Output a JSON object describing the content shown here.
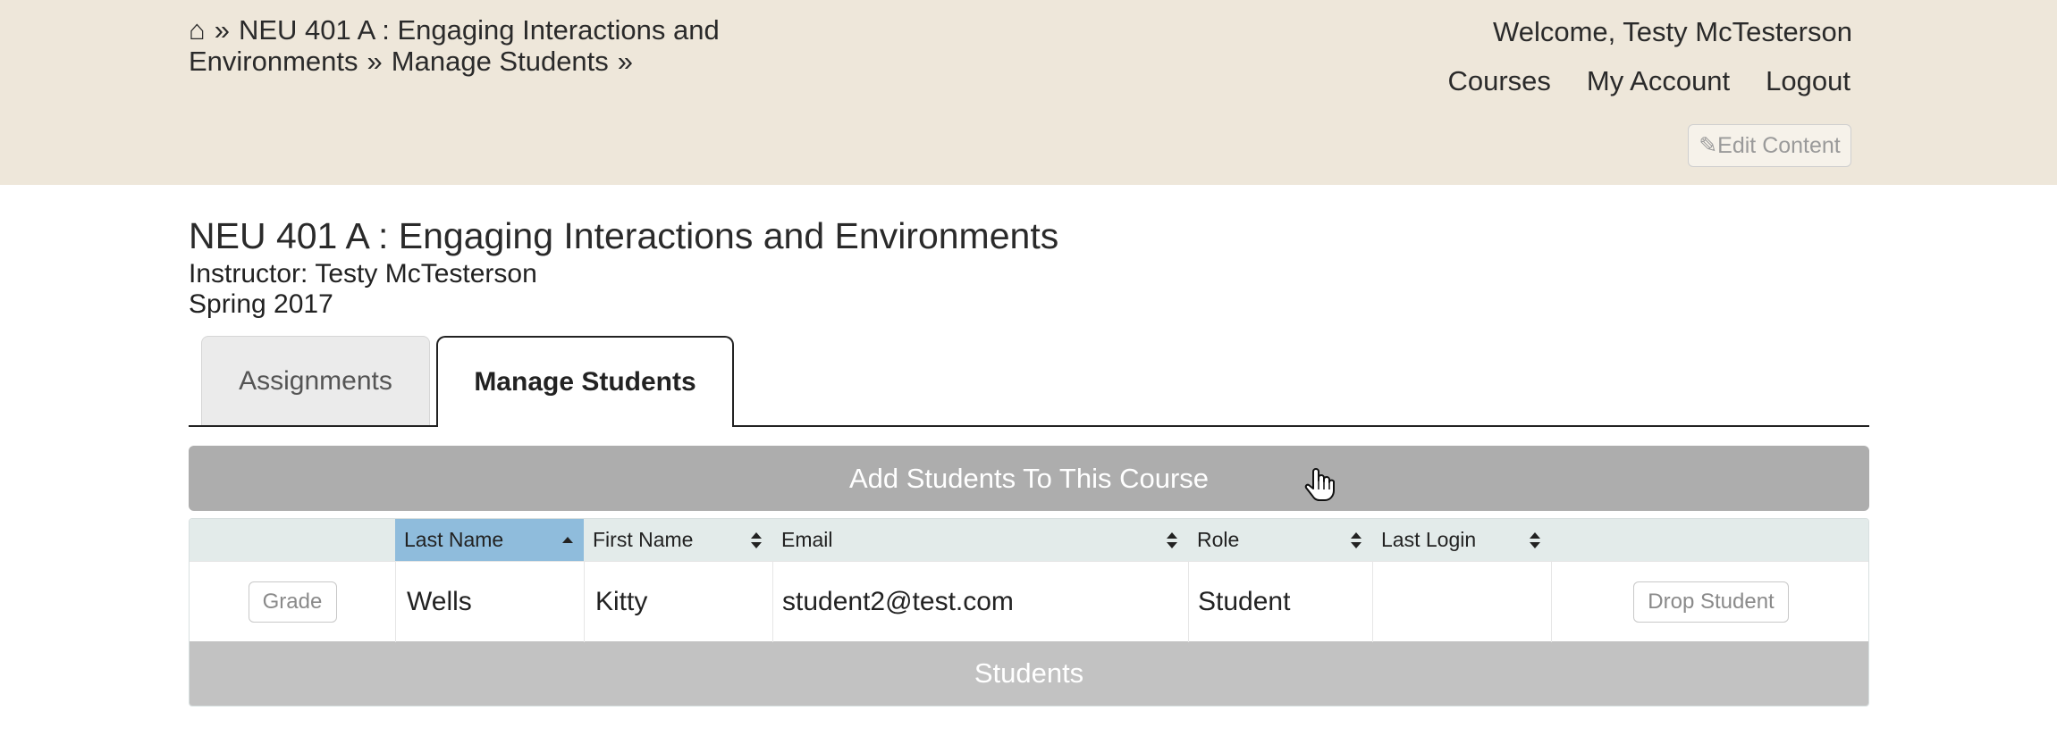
{
  "breadcrumb": {
    "home_icon": "⌂",
    "separator": "»",
    "items": [
      "NEU 401 A : Engaging Interactions and Environments",
      "Manage Students"
    ]
  },
  "header": {
    "welcome": "Welcome, Testy McTesterson",
    "nav": [
      "Courses",
      "My Account",
      "Logout"
    ],
    "edit_content": "✎Edit Content"
  },
  "course": {
    "title": "NEU 401 A : Engaging Interactions and Environments",
    "instructor_label": "Instructor:",
    "instructor_name": "Testy McTesterson",
    "term": "Spring 2017"
  },
  "tabs": [
    {
      "label": "Assignments",
      "active": false
    },
    {
      "label": "Manage Students",
      "active": true
    }
  ],
  "add_students_label": "Add Students To This Course",
  "table": {
    "columns": [
      "",
      "Last Name",
      "First Name",
      "Email",
      "Role",
      "Last Login",
      ""
    ],
    "sorted_column": "Last Name",
    "rows": [
      {
        "grade_label": "Grade",
        "last_name": "Wells",
        "first_name": "Kitty",
        "email": "student2@test.com",
        "role": "Student",
        "last_login": "",
        "drop_label": "Drop Student"
      }
    ],
    "footer": "Students"
  },
  "colors": {
    "header_bg": "#eee7da",
    "sorted_header_bg": "#8fbcdc",
    "add_button_bg": "#adadad"
  }
}
